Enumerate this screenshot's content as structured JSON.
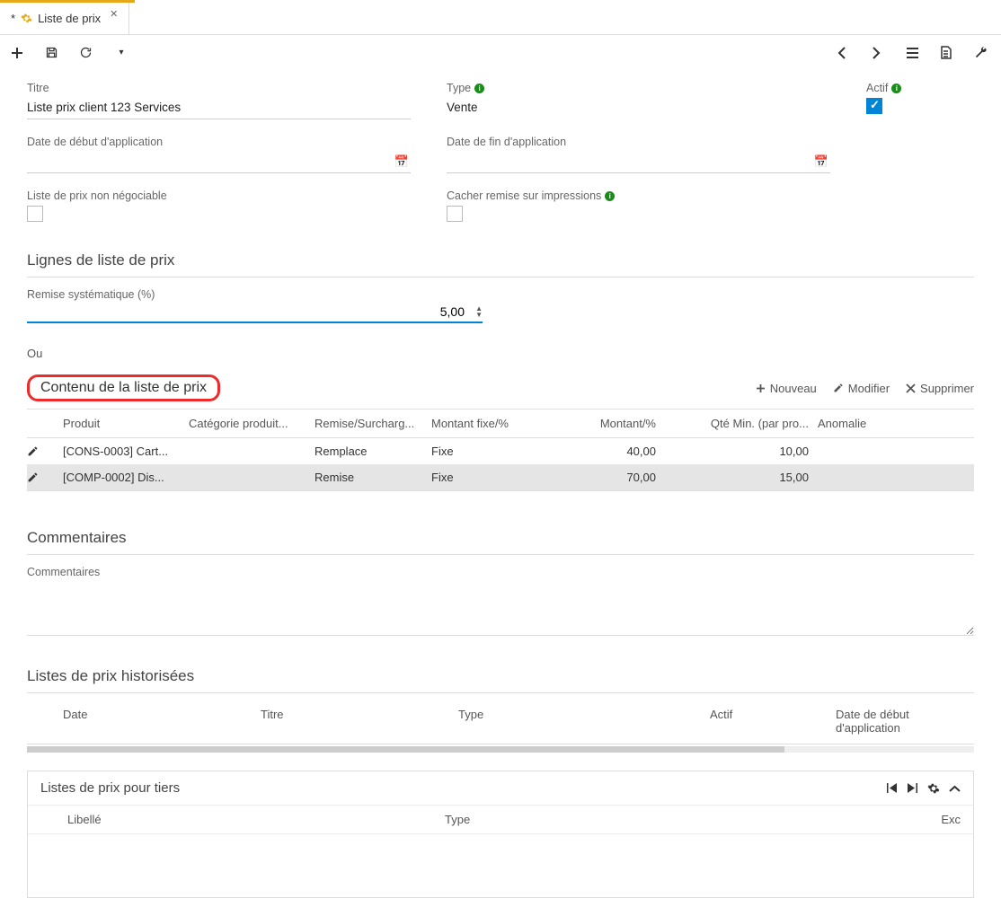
{
  "tab": {
    "marker": "*",
    "title": "Liste de prix"
  },
  "fields": {
    "titre_label": "Titre",
    "titre_value": "Liste prix client 123 Services",
    "type_label": "Type",
    "type_value": "Vente",
    "actif_label": "Actif",
    "date_debut_label": "Date de début d'application",
    "date_fin_label": "Date de fin d'application",
    "non_negociable_label": "Liste de prix non négociable",
    "cacher_remise_label": "Cacher remise sur impressions"
  },
  "lignes": {
    "section_title": "Lignes de liste de prix",
    "remise_label": "Remise systématique (%)",
    "remise_value": "5,00",
    "ou": "Ou"
  },
  "contenu": {
    "title": "Contenu de la liste de prix",
    "actions": {
      "nouveau": "Nouveau",
      "modifier": "Modifier",
      "supprimer": "Supprimer"
    },
    "columns": {
      "produit": "Produit",
      "categorie": "Catégorie produit...",
      "remise": "Remise/Surcharg...",
      "montfix": "Montant fixe/%",
      "montant": "Montant/%",
      "qte": "Qté Min. (par pro...",
      "anomalie": "Anomalie"
    },
    "rows": [
      {
        "produit": "[CONS-0003] Cart...",
        "categorie": "",
        "remise": "Remplace",
        "montfix": "Fixe",
        "montant": "40,00",
        "qte": "10,00",
        "anomalie": ""
      },
      {
        "produit": "[COMP-0002] Dis...",
        "categorie": "",
        "remise": "Remise",
        "montfix": "Fixe",
        "montant": "70,00",
        "qte": "15,00",
        "anomalie": ""
      }
    ]
  },
  "commentaires": {
    "title": "Commentaires",
    "label": "Commentaires",
    "value": ""
  },
  "historisees": {
    "title": "Listes de prix historisées",
    "columns": {
      "date": "Date",
      "titre": "Titre",
      "type": "Type",
      "actif": "Actif",
      "debut": "Date de début d'application"
    }
  },
  "tiers": {
    "title": "Listes de prix pour tiers",
    "columns": {
      "libelle": "Libellé",
      "type": "Type",
      "exc": "Exc"
    }
  }
}
